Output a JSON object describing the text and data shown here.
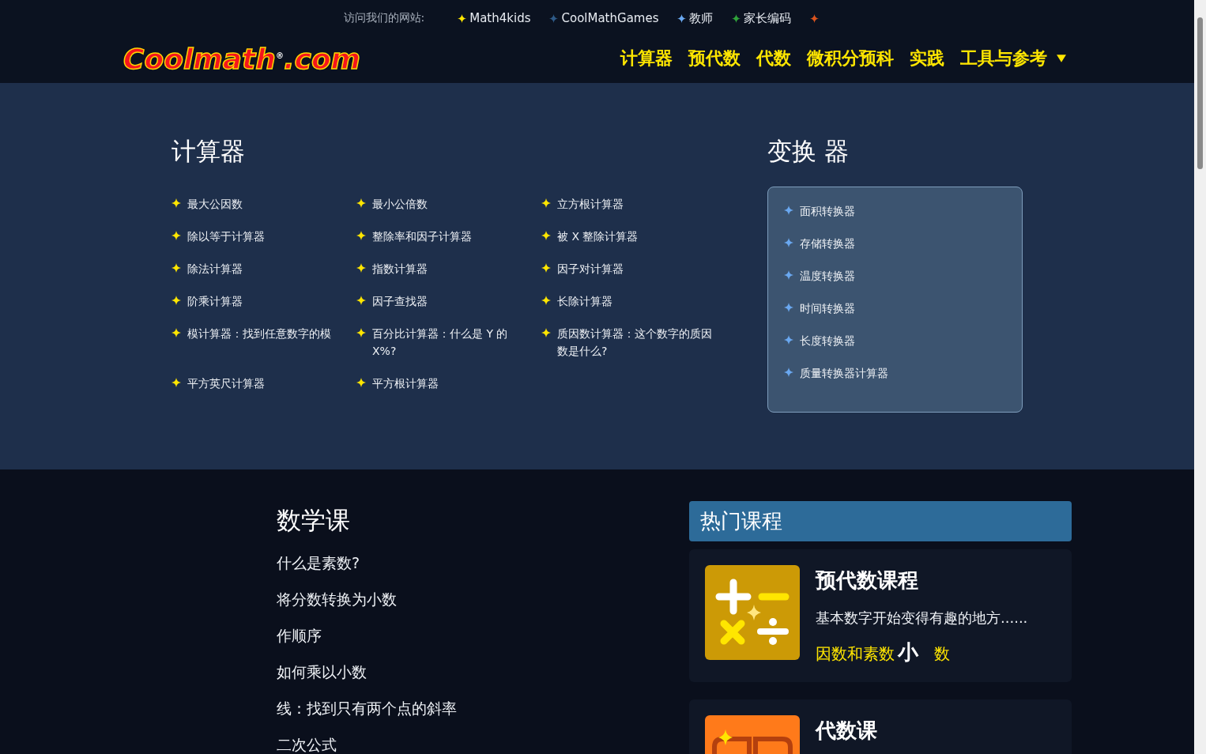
{
  "top_bar": {
    "label": "访问我们的网站:",
    "sites": [
      {
        "label": "Math4kids",
        "color": "#ffe600"
      },
      {
        "label": "CoolMathGames",
        "color": "#2e5a87"
      },
      {
        "label": "教师",
        "color": "#6aa8f0"
      },
      {
        "label": "家长编码",
        "color": "#2fa23a"
      },
      {
        "color": "#d9531e"
      }
    ]
  },
  "header": {
    "logo": "Coolmath$^{®}$.com",
    "nav": [
      {
        "label": "计算器"
      },
      {
        "label": "预代数"
      },
      {
        "label": "代数"
      },
      {
        "label": "微积分预科"
      },
      {
        "label": "实践"
      },
      {
        "label": "工具与参考",
        "dropdown": true
      }
    ]
  },
  "calculators": {
    "title": "计算器",
    "items": [
      "最大公因数",
      "最小公倍数",
      "立方根计算器",
      "除以等于计算器",
      "整除率和因子计算器",
      "被 X 整除计算器",
      "除法计算器",
      "指数计算器",
      "因子对计算器",
      "阶乘计算器",
      "因子查找器",
      "长除计算器",
      "模计算器：找到任意数字的模",
      "百分比计算器：什么是 Y 的 X%?",
      "质因数计算器：这个数字的质因数是什么?",
      "平方英尺计算器",
      "平方根计算器"
    ]
  },
  "converters": {
    "title": "变换 器",
    "items": [
      "面积转换器",
      "存储转换器",
      "温度转换器",
      "时间转换器",
      "长度转换器",
      "质量转换器计算器"
    ]
  },
  "lessons": {
    "title": "数学课",
    "items": [
      "什么是素数?",
      "将分数转换为小数",
      "作顺序",
      "如何乘以小数",
      "线：找到只有两个点的斜率",
      "二次公式"
    ]
  },
  "popular": {
    "title": "热门课程",
    "courses": [
      {
        "title": "预代数课程",
        "description": "基本数字开始变得有趣的地方......",
        "links": [
          {
            "kind": "link",
            "label": "因数和素数"
          },
          {
            "kind": "bold",
            "label": "小"
          },
          {
            "kind": "link",
            "label": "数"
          }
        ]
      },
      {
        "title": "代数课"
      }
    ]
  }
}
